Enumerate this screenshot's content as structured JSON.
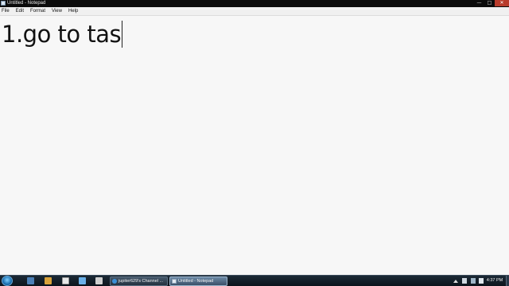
{
  "window": {
    "title": "Untitled - Notepad",
    "buttons": {
      "minimize": "—",
      "maximize": "□",
      "close": "✕"
    }
  },
  "menu": [
    "File",
    "Edit",
    "Format",
    "View",
    "Help"
  ],
  "editor": {
    "content": "1.go to tas"
  },
  "taskbar": {
    "tasks": [
      {
        "label": "jupiter629's Channel ...",
        "active": false
      },
      {
        "label": "Untitled - Notepad",
        "active": true
      }
    ],
    "clock": "4:37 PM"
  }
}
